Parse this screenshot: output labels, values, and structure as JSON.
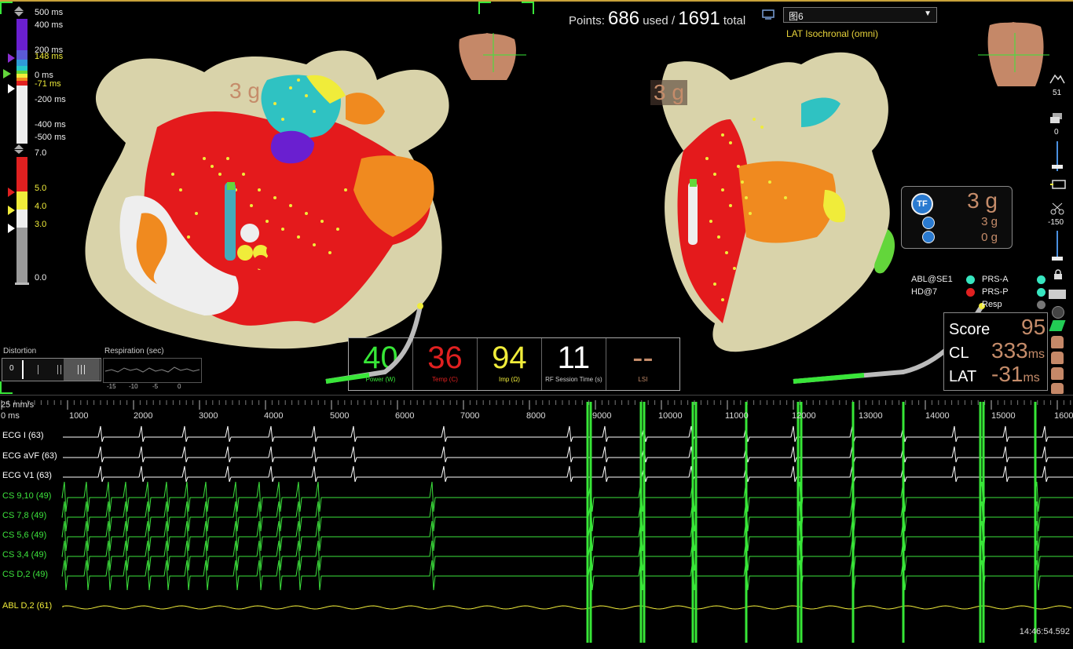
{
  "scale_times": {
    "t500": "500 ms",
    "t400": "400 ms",
    "t200": "200 ms",
    "t148": "148 ms",
    "t0": "0 ms",
    "tm71": "-71 ms",
    "tm200": "-200 ms",
    "tm400": "-400 ms",
    "tm500": "-500 ms"
  },
  "scale_force": {
    "f7": "7.0",
    "f5": "5.0",
    "f4": "4.0",
    "f3": "3.0",
    "f0": "0.0"
  },
  "distortion": {
    "label": "Distortion",
    "value": "0"
  },
  "respiration": {
    "label": "Respiration (sec)",
    "ticks": [
      "-15",
      "-10",
      "-5",
      "0"
    ]
  },
  "points": {
    "prefix": "Points:",
    "used": "686",
    "used_label": "used /",
    "total": "1691",
    "total_label": "total"
  },
  "map_select": {
    "value": "图6",
    "subtitle": "LAT Isochronal (omni)"
  },
  "left_force": "3 g",
  "right_force": "3 g",
  "rf": [
    {
      "value": "40",
      "caption": "Power (W)",
      "color": "#37e637"
    },
    {
      "value": "36",
      "caption": "Temp (C)",
      "color": "#e02020"
    },
    {
      "value": "94",
      "caption": "Imp (Ω)",
      "color": "#f0ec3a"
    },
    {
      "value": "11",
      "caption": "RF Session Time (s)",
      "color": "#ffffff"
    },
    {
      "value": "--",
      "caption": "LSI",
      "color": "#c58c6a"
    }
  ],
  "tf_panel": {
    "badge": "TF",
    "main": "3 g",
    "sub1": "3 g",
    "sub2": "0 g"
  },
  "legend": {
    "abl": "ABL@SE1",
    "hd": "HD@7",
    "prs_a": "PRS-A",
    "prs_p": "PRS-P",
    "resp": "Resp"
  },
  "score_panel": {
    "score_label": "Score",
    "score": "95",
    "cl_label": "CL",
    "cl": "333",
    "cl_unit": "ms",
    "lat_label": "LAT",
    "lat": "-31",
    "lat_unit": "ms"
  },
  "tools": {
    "t51": "51",
    "t0": "0",
    "tm150": "-150"
  },
  "ecg": {
    "speed": "25 mm/s",
    "zero": "0 ms",
    "ticks": [
      "1000",
      "2000",
      "3000",
      "4000",
      "5000",
      "6000",
      "7000",
      "8000",
      "9000",
      "10000",
      "11000",
      "12000",
      "13000",
      "14000",
      "15000",
      "1600"
    ],
    "channels": [
      {
        "label": "ECG I (63)",
        "color": "#ffffff"
      },
      {
        "label": "ECG aVF (63)",
        "color": "#ffffff"
      },
      {
        "label": "ECG V1 (63)",
        "color": "#ffffff"
      },
      {
        "label": "CS 9,10 (49)",
        "color": "#3de33d"
      },
      {
        "label": "CS 7,8 (49)",
        "color": "#3de33d"
      },
      {
        "label": "CS 5,6 (49)",
        "color": "#3de33d"
      },
      {
        "label": "CS 3,4 (49)",
        "color": "#3de33d"
      },
      {
        "label": "CS D,2 (49)",
        "color": "#3de33d"
      },
      {
        "label": "ABL D,2 (61)",
        "color": "#f0ec3a"
      }
    ],
    "clock": "14:46:54.592"
  }
}
